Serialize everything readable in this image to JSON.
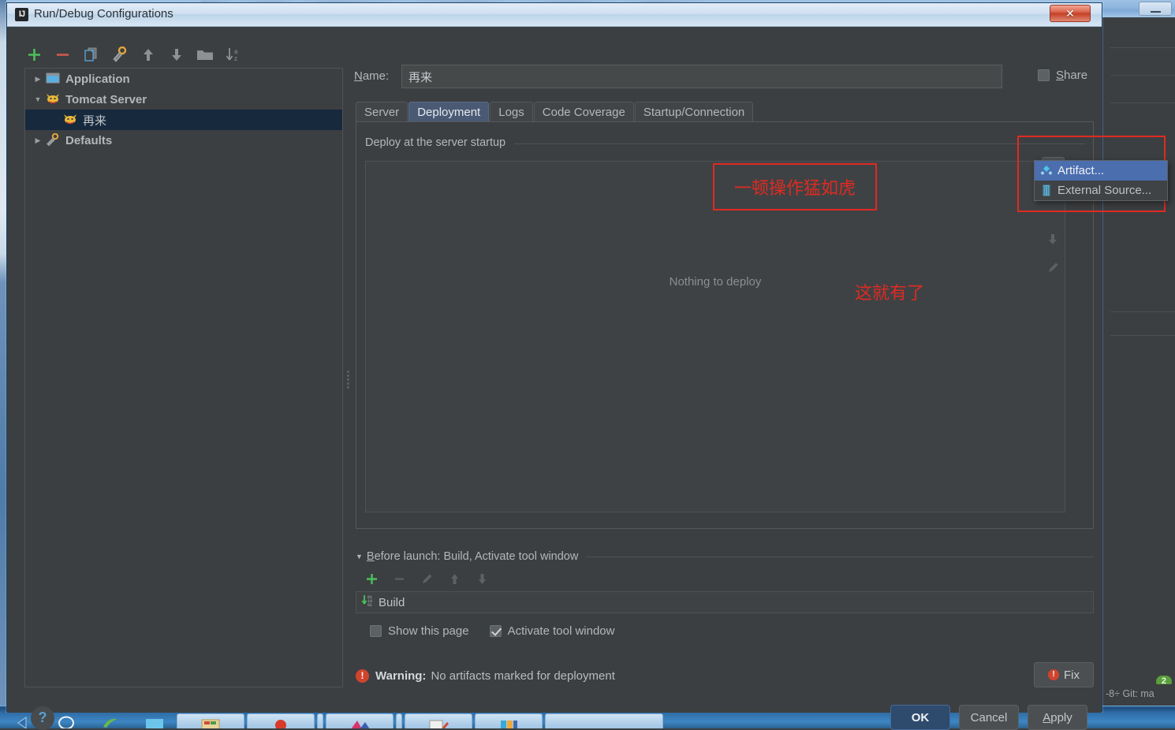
{
  "background_ide": {
    "status_text": "-8÷   Git: ma",
    "badge_count": "2"
  },
  "dialog": {
    "title": "Run/Debug Configurations",
    "icon_label": "IJ",
    "close_label": "✕",
    "left_toolbar": [
      {
        "name": "add",
        "glyph": "+",
        "color": "#4bbf5a"
      },
      {
        "name": "remove",
        "glyph": "−",
        "color": "#d05a4e"
      },
      {
        "name": "copy",
        "glyph": "copy-icon",
        "color": "#6aa9d8"
      },
      {
        "name": "edit-templates",
        "glyph": "wrench-icon",
        "color": "#e0a63a"
      },
      {
        "name": "move-up",
        "glyph": "↑",
        "color": "#8d9194"
      },
      {
        "name": "move-down",
        "glyph": "↓",
        "color": "#8d9194"
      },
      {
        "name": "new-folder",
        "glyph": "folder-icon",
        "color": "#8d9194"
      },
      {
        "name": "sort-alphabetically",
        "glyph": "sort-az-icon",
        "color": "#8d9194"
      }
    ],
    "tree": [
      {
        "label": "Application",
        "expanded": false,
        "selected": false,
        "level": 0,
        "icon": "application-icon"
      },
      {
        "label": "Tomcat Server",
        "expanded": true,
        "selected": false,
        "level": 0,
        "icon": "tomcat-icon"
      },
      {
        "label": "再来",
        "expanded": null,
        "selected": true,
        "level": 1,
        "icon": "tomcat-icon"
      },
      {
        "label": "Defaults",
        "expanded": false,
        "selected": false,
        "level": 0,
        "icon": "wrench-icon"
      }
    ],
    "name": {
      "label": "Name:",
      "label_mnemonic": "N",
      "value": "再来"
    },
    "share": {
      "label": "Share",
      "mnemonic": "S",
      "checked": false
    },
    "tabs": [
      {
        "label": "Server",
        "active": false
      },
      {
        "label": "Deployment",
        "active": true
      },
      {
        "label": "Logs",
        "active": false
      },
      {
        "label": "Code Coverage",
        "active": false
      },
      {
        "label": "Startup/Connection",
        "active": false
      }
    ],
    "deployment": {
      "caption": "Deploy at the server startup",
      "empty_text": "Nothing to deploy",
      "vertical_toolbar": [
        {
          "name": "add",
          "glyph": "+",
          "state": "pressed"
        },
        {
          "name": "remove",
          "glyph": "−",
          "state": "disabled"
        },
        {
          "name": "edit",
          "glyph": "pencil-icon",
          "state": "disabled"
        }
      ]
    },
    "popup_menu": {
      "items": [
        {
          "label": "Artifact...",
          "icon": "artifact-icon",
          "highlighted": true
        },
        {
          "label": "External Source...",
          "icon": "external-source-icon",
          "highlighted": false
        }
      ]
    },
    "annotations": [
      {
        "text": "一顿操作猛如虎",
        "kind": "boxed-text",
        "color": "#e02a22"
      },
      {
        "text": "这就有了",
        "kind": "text",
        "color": "#e02a22"
      },
      {
        "text": "",
        "kind": "box-only",
        "color": "#e02a22"
      }
    ],
    "before_launch": {
      "title": "Before launch: Build, Activate tool window",
      "title_mnemonic": "B",
      "toolbar": [
        {
          "name": "add",
          "glyph": "+",
          "state": "enabled"
        },
        {
          "name": "remove",
          "glyph": "−",
          "state": "disabled"
        },
        {
          "name": "edit",
          "glyph": "pencil-icon",
          "state": "disabled"
        },
        {
          "name": "move-up",
          "glyph": "↑",
          "state": "disabled"
        },
        {
          "name": "move-down",
          "glyph": "↓",
          "state": "disabled"
        }
      ],
      "tasks": [
        {
          "label": "Build",
          "icon": "build-icon"
        }
      ],
      "checkboxes": [
        {
          "label": "Show this page",
          "checked": false
        },
        {
          "label": "Activate tool window",
          "checked": true
        }
      ]
    },
    "warning": {
      "prefix": "Warning:",
      "message": "No artifacts marked for deployment",
      "fix_label": "Fix"
    },
    "help_label": "?",
    "buttons": [
      {
        "label": "OK",
        "primary": true
      },
      {
        "label": "Cancel",
        "primary": false
      },
      {
        "label": "Apply",
        "primary": false,
        "mnemonic": "A"
      }
    ]
  },
  "colors": {
    "accent_blue": "#4b6eaf",
    "selection_navy": "#16293d",
    "annotation_red": "#e02a22",
    "panel_bg": "#3c3f41",
    "green_plus": "#4bbf5a",
    "warning_red": "#d0442e"
  }
}
